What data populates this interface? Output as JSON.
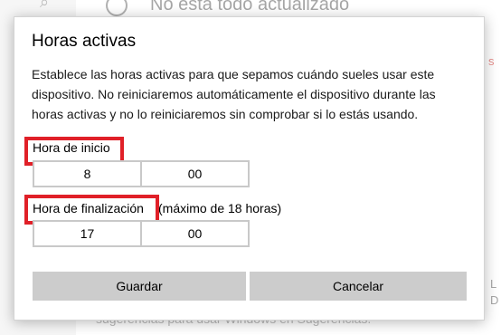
{
  "background": {
    "update_status": "No está todo actualizado",
    "bottom_text": "sugerencias para usar Windows en Sugerencias.",
    "right_text": "s",
    "right_text2": "L\nD"
  },
  "dialog": {
    "title": "Horas activas",
    "description": "Establece las horas activas para que sepamos cuándo sueles usar este dispositivo. No reiniciaremos automáticamente el dispositivo durante las horas activas y no lo reiniciaremos sin comprobar si lo estás usando.",
    "start": {
      "label": "Hora de inicio",
      "hour": "8",
      "minute": "00"
    },
    "end": {
      "label": "Hora de finalización",
      "hint": "(máximo de 18 horas)",
      "hour": "17",
      "minute": "00"
    },
    "buttons": {
      "save": "Guardar",
      "cancel": "Cancelar"
    },
    "highlight_color": "#e02028"
  }
}
